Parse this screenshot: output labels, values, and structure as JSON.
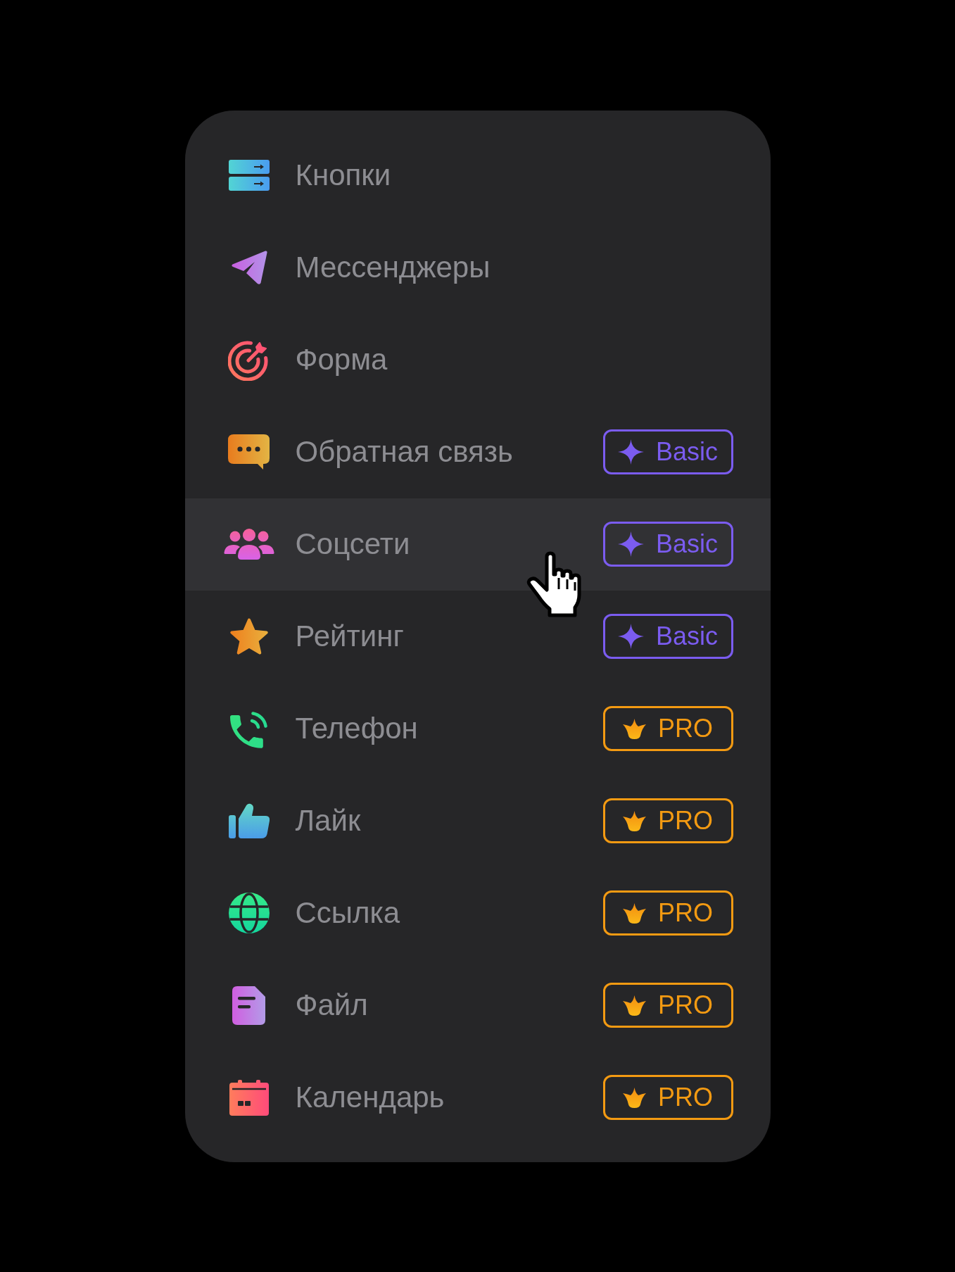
{
  "menu": {
    "items": [
      {
        "label": "Кнопки",
        "selected": false
      },
      {
        "label": "Мессенджеры",
        "selected": false
      },
      {
        "label": "Форма",
        "selected": false
      },
      {
        "label": "Обратная связь",
        "selected": false,
        "badge": {
          "kind": "basic",
          "label": "Basic"
        }
      },
      {
        "label": "Соцсети",
        "selected": true,
        "badge": {
          "kind": "basic",
          "label": "Basic"
        }
      },
      {
        "label": "Рейтинг",
        "selected": false,
        "badge": {
          "kind": "basic",
          "label": "Basic"
        }
      },
      {
        "label": "Телефон",
        "selected": false,
        "badge": {
          "kind": "pro",
          "label": "PRO"
        }
      },
      {
        "label": "Лайк",
        "selected": false,
        "badge": {
          "kind": "pro",
          "label": "PRO"
        }
      },
      {
        "label": "Ссылка",
        "selected": false,
        "badge": {
          "kind": "pro",
          "label": "PRO"
        }
      },
      {
        "label": "Файл",
        "selected": false,
        "badge": {
          "kind": "pro",
          "label": "PRO"
        }
      },
      {
        "label": "Календарь",
        "selected": false,
        "badge": {
          "kind": "pro",
          "label": "PRO"
        }
      }
    ]
  }
}
